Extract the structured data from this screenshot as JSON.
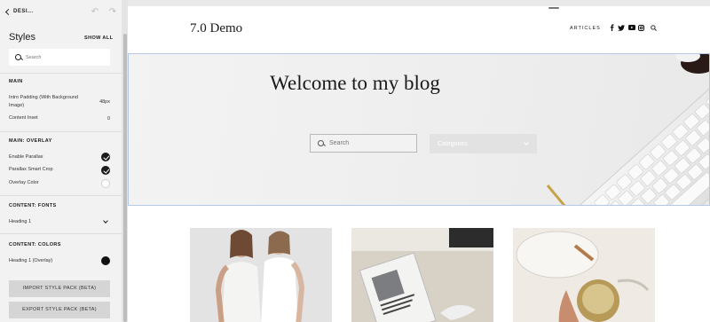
{
  "panel": {
    "back_label": "DESI...",
    "title": "Styles",
    "show_all": "SHOW ALL",
    "search_placeholder": "Search",
    "sections": {
      "main": "MAIN",
      "main_overlay": "MAIN: OVERLAY",
      "content_fonts": "CONTENT: FONTS",
      "content_colors": "CONTENT: COLORS"
    },
    "rows": {
      "intro_padding_label": "Intro Padding (With Background Image)",
      "intro_padding_value": "48px",
      "content_inset_label": "Content Inset",
      "content_inset_value": "0",
      "enable_parallax": "Enable Parallax",
      "parallax_smart_crop": "Parallax Smart Crop",
      "overlay_color": "Overlay Color",
      "heading_1": "Heading 1",
      "heading_1_overlay": "Heading 1 (Overlay)"
    },
    "buttons": {
      "import": "IMPORT STYLE PACK (BETA)",
      "export": "EXPORT STYLE PACK (BETA)"
    },
    "colors": {
      "panel_bg": "#f2f2f2",
      "heading_1_overlay_swatch": "#111111"
    }
  },
  "site": {
    "title": "7.0 Demo",
    "nav": {
      "articles": "ARTICLES"
    },
    "social_icons": [
      "facebook-icon",
      "twitter-icon",
      "youtube-icon",
      "instagram-icon",
      "search-icon"
    ],
    "hero": {
      "title": "Welcome to my blog",
      "search_placeholder": "Search",
      "categories_label": "Categories"
    }
  }
}
